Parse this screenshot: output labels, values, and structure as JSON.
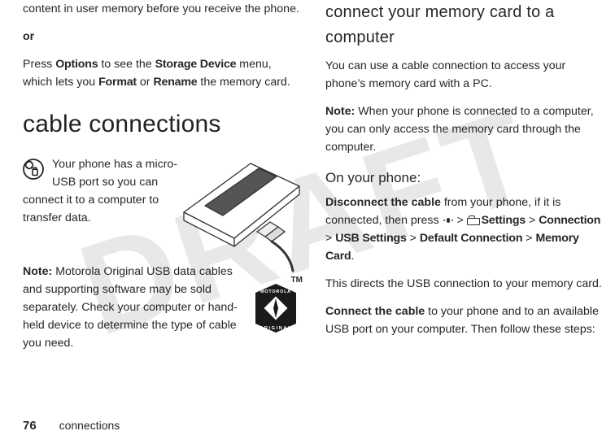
{
  "watermark": "DRAFT",
  "left": {
    "intro_tail": "content in user memory before you receive the phone.",
    "or": "or",
    "options_para_1": "Press ",
    "options_label": "Options",
    "options_para_2": " to see the ",
    "storage_label": "Storage Device",
    "options_para_3": " menu, which lets you ",
    "format_label": "Format",
    "options_para_4": " or ",
    "rename_label": "Rename",
    "options_para_5": " the memory card.",
    "section_heading": "cable connections",
    "usb_para": "Your phone has a micro-USB port so you can connect it to a computer to transfer data.",
    "note_label": "Note:",
    "note_body": " Motorola Original USB data cables and supporting software may be sold separately. Check your computer or hand-held device to determine the type of cable you need.",
    "tm": "TM"
  },
  "right": {
    "subhead": "connect your memory card to a computer",
    "p1": "You can use a cable connection to access your phone’s memory card with a PC.",
    "note_label": "Note:",
    "note_body": " When your phone is connected to a computer, you can only access the memory card through the computer.",
    "mini": "On your phone:",
    "disc_label": "Disconnect the cable",
    "disc_body_1": " from your phone, if it is connected, then press ",
    "gt": " > ",
    "settings_label": "Settings",
    "connection_label": "Connection",
    "usb_settings_label": "USB Settings",
    "default_conn_label": "Default Connection",
    "memcard_label": "Memory Card",
    "period": ".",
    "p_direct": "This directs the USB connection to your memory card.",
    "conn_label": "Connect the cable",
    "conn_body": " to your phone and to an available USB port on your computer. Then follow these steps:"
  },
  "footer": {
    "page": "76",
    "section": "connections"
  }
}
